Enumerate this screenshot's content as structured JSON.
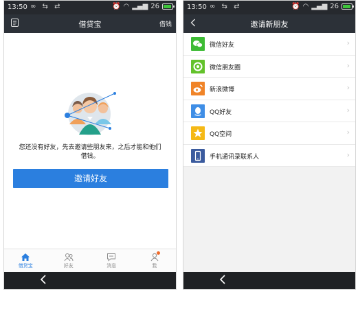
{
  "status": {
    "time": "13:50",
    "signal": "26"
  },
  "left": {
    "title": "借贷宝",
    "header_right": "借钱",
    "empty_message": "您还没有好友，先去邀请些朋友来，之后才能和他们借钱。",
    "invite_button": "邀请好友",
    "tabs": [
      {
        "label": "借贷宝",
        "icon": "home-icon",
        "active": true
      },
      {
        "label": "好友",
        "icon": "friends-icon",
        "active": false
      },
      {
        "label": "消息",
        "icon": "message-icon",
        "active": false
      },
      {
        "label": "我",
        "icon": "profile-icon",
        "active": false,
        "badge": true
      }
    ]
  },
  "right": {
    "title": "邀请新朋友",
    "items": [
      {
        "label": "微信好友",
        "icon": "wechat-icon",
        "color": "#3dbb34"
      },
      {
        "label": "微信朋友圈",
        "icon": "wechat-moments-icon",
        "color": "#63c22b"
      },
      {
        "label": "新浪微博",
        "icon": "weibo-icon",
        "color": "#f08428"
      },
      {
        "label": "QQ好友",
        "icon": "qq-icon",
        "color": "#3f8ee6"
      },
      {
        "label": "QQ空间",
        "icon": "qzone-icon",
        "color": "#f5b916"
      },
      {
        "label": "手机通讯录联系人",
        "icon": "phone-contacts-icon",
        "color": "#3b5b9e"
      }
    ]
  },
  "colors": {
    "accent": "#2b7fdf",
    "titlebar": "#2c3138",
    "statusbar": "#26292e"
  }
}
